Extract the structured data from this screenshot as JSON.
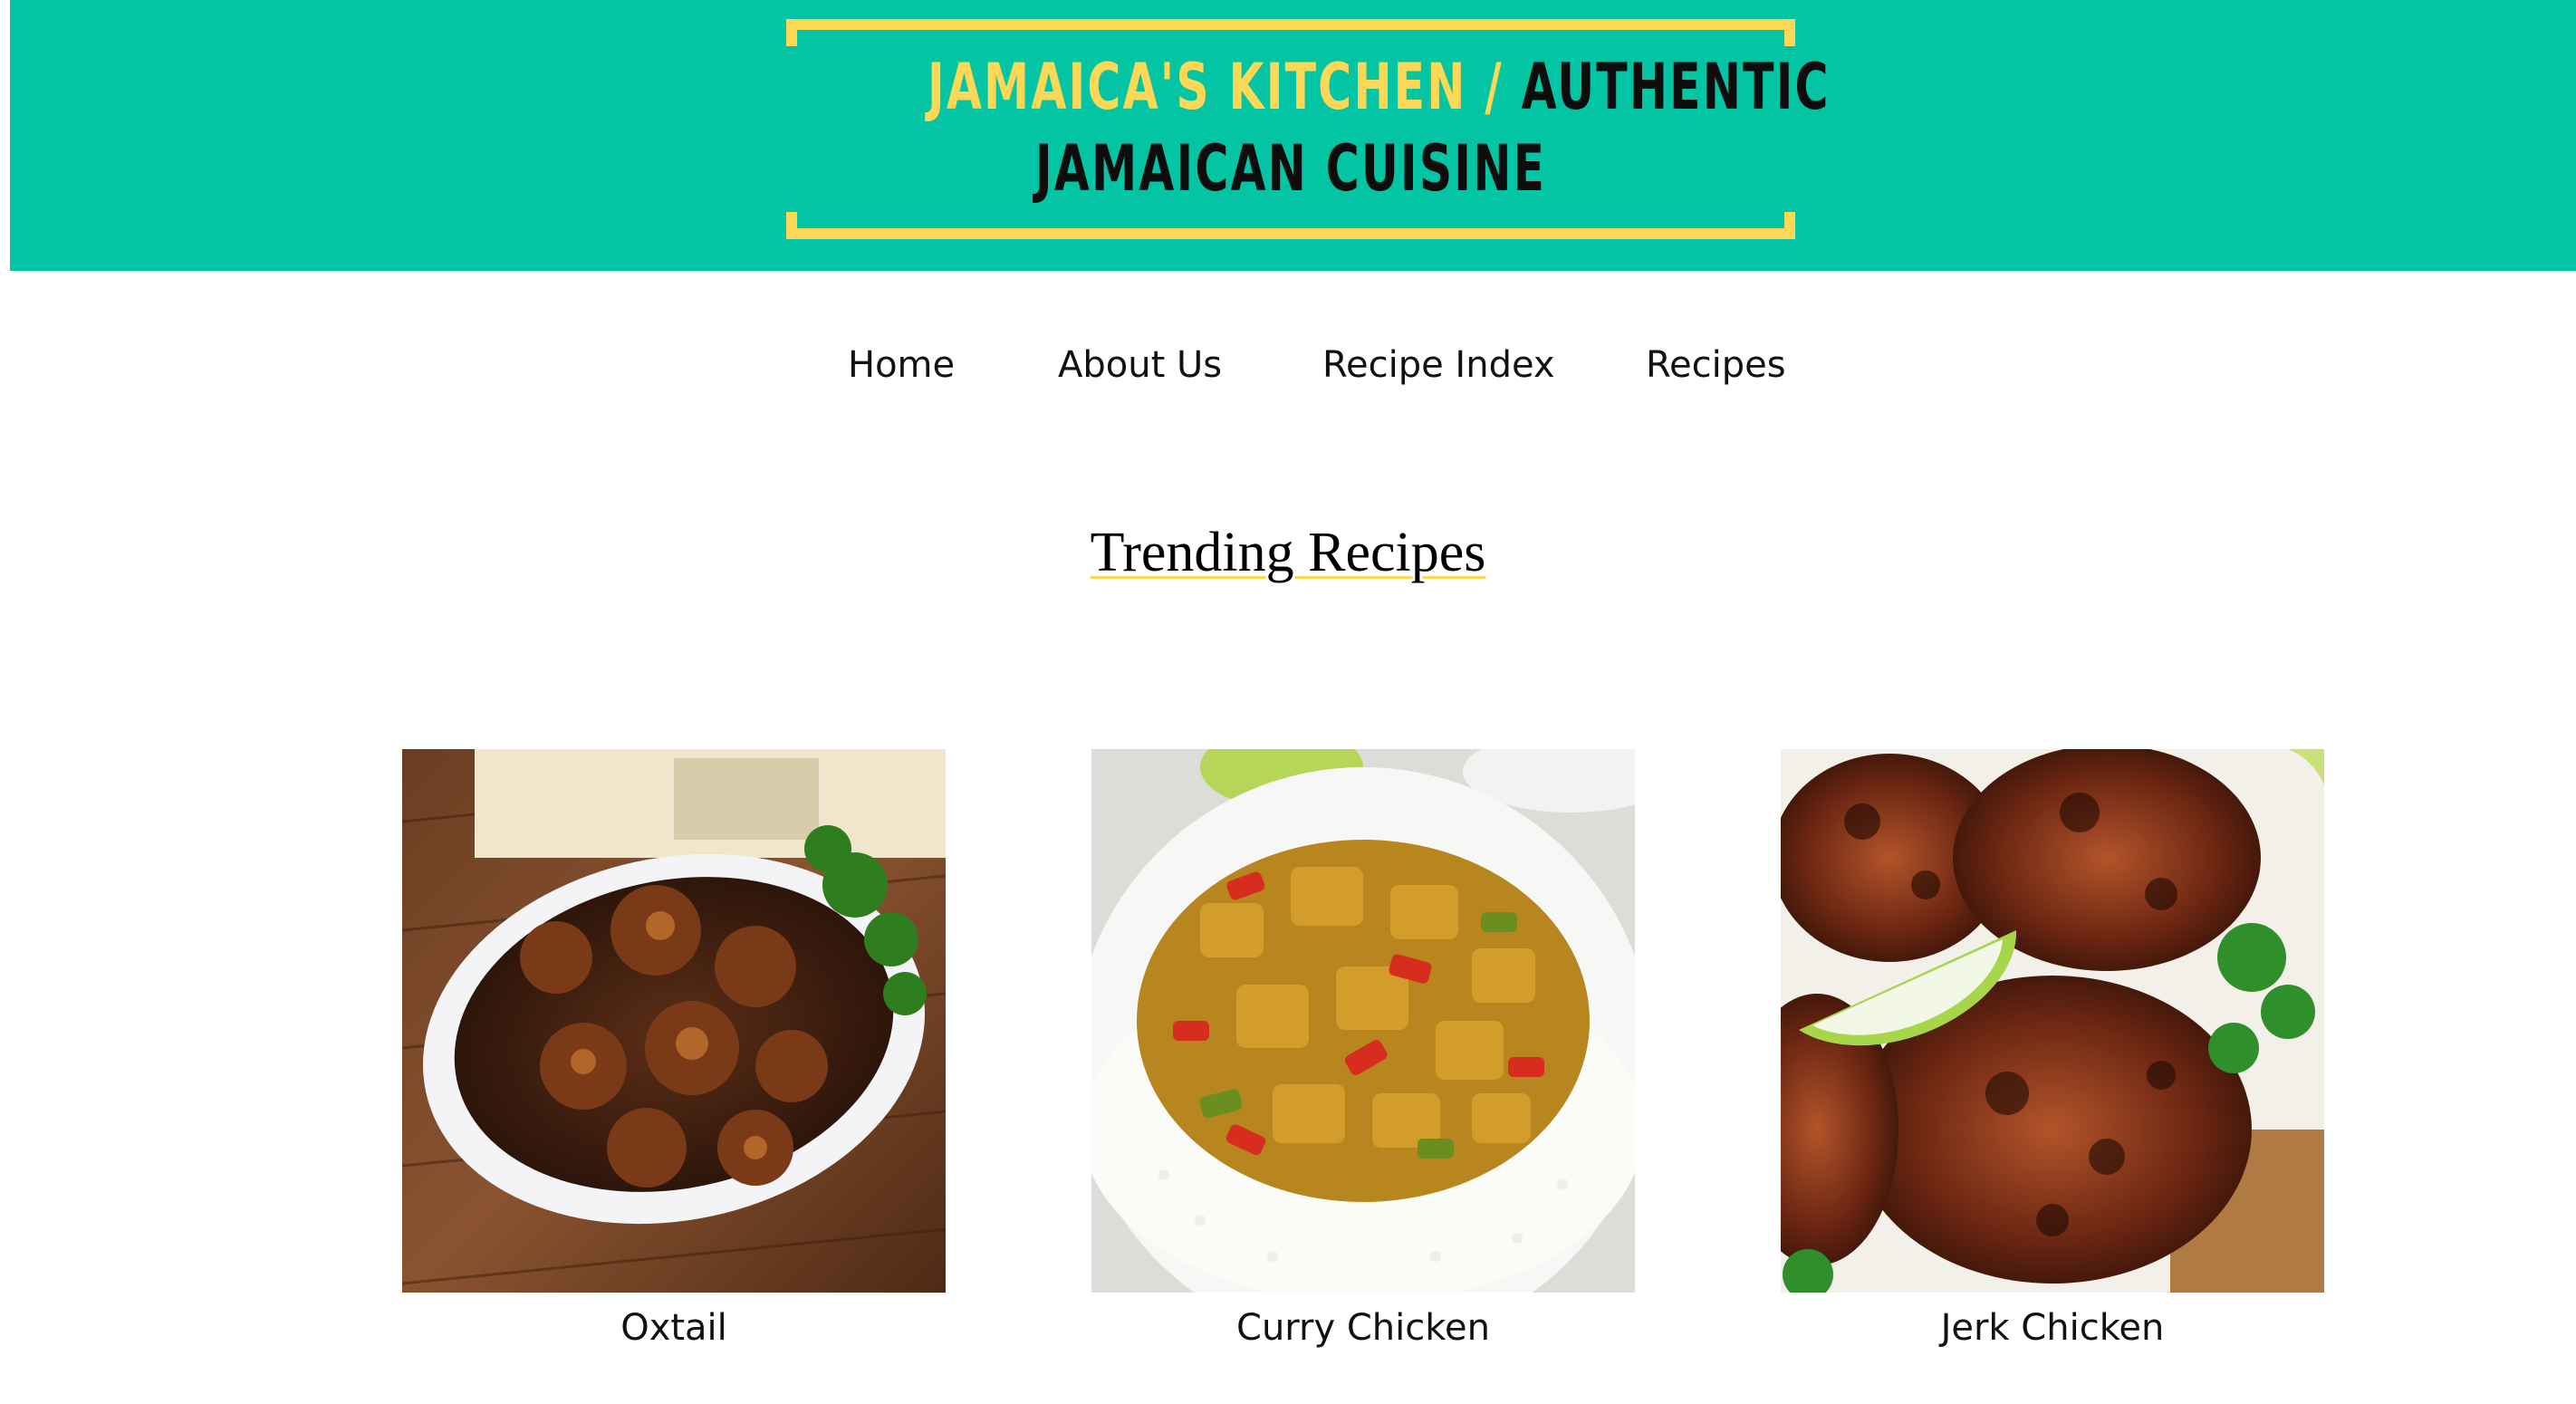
{
  "header": {
    "logo_yellow": "JAMAICA'S KITCHEN /",
    "logo_black_line1": "AUTHENTIC",
    "logo_line2": "JAMAICAN CUISINE",
    "background_color": "#03c5a3",
    "accent_color": "#fcd856"
  },
  "nav": {
    "items": [
      {
        "label": "Home"
      },
      {
        "label": "About Us"
      },
      {
        "label": "Recipe Index"
      },
      {
        "label": "Recipes"
      }
    ]
  },
  "main": {
    "section_title": "Trending Recipes",
    "recipes": [
      {
        "name": "Oxtail",
        "image": "oxtail-photo"
      },
      {
        "name": "Curry Chicken",
        "image": "curry-chicken-photo"
      },
      {
        "name": "Jerk Chicken",
        "image": "jerk-chicken-photo"
      }
    ]
  }
}
